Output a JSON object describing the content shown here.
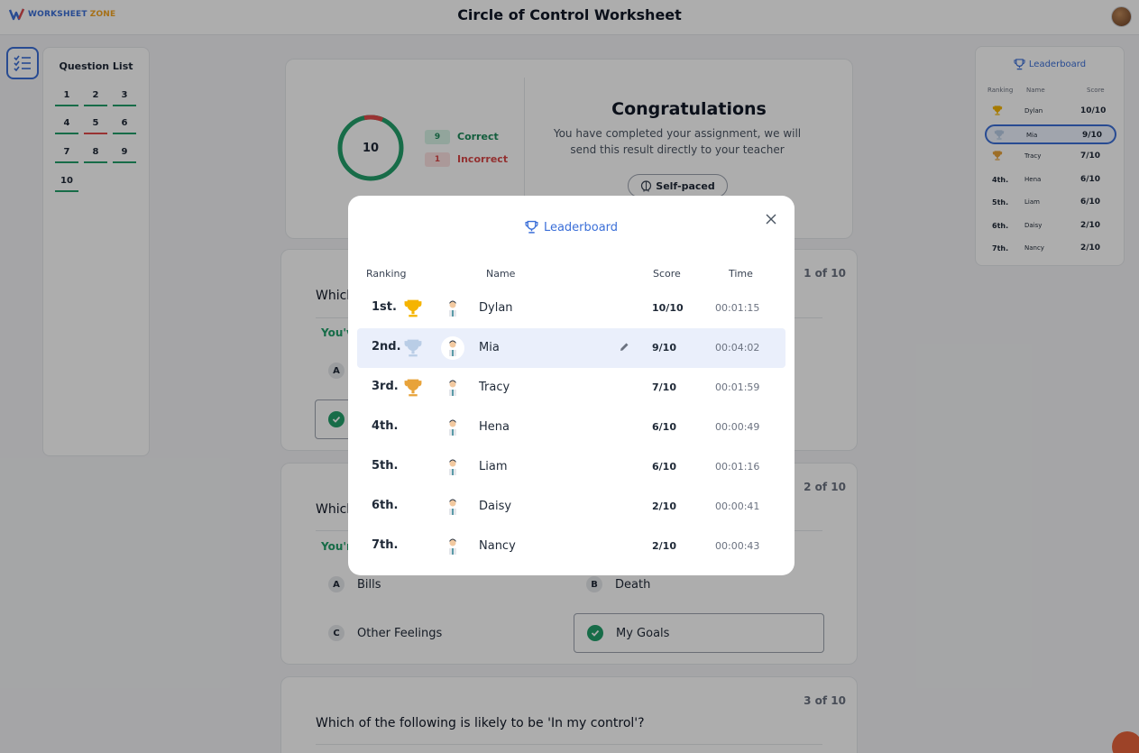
{
  "header": {
    "logo_part1": "WORKSHEET",
    "logo_part2": "ZONE",
    "title": "Circle of Control Worksheet"
  },
  "question_list": {
    "title": "Question List",
    "items": [
      {
        "label": "1",
        "status": "correct"
      },
      {
        "label": "2",
        "status": "correct"
      },
      {
        "label": "3",
        "status": "correct"
      },
      {
        "label": "4",
        "status": "correct"
      },
      {
        "label": "5",
        "status": "incorrect"
      },
      {
        "label": "6",
        "status": "correct"
      },
      {
        "label": "7",
        "status": "correct"
      },
      {
        "label": "8",
        "status": "correct"
      },
      {
        "label": "9",
        "status": "correct"
      },
      {
        "label": "10",
        "status": "correct"
      }
    ]
  },
  "result": {
    "score": "10",
    "correct_count": "9",
    "correct_label": "Correct",
    "incorrect_count": "1",
    "incorrect_label": "Incorrect",
    "heading": "Congratulations",
    "message": "You have completed your assignment, we will send this result directly to your teacher",
    "mode_label": "Self-paced",
    "colors": {
      "correct": "#22a06b",
      "incorrect": "#e24c4c"
    }
  },
  "questions": [
    {
      "counter": "1 of 10",
      "text": "Which",
      "feedback": "You'v",
      "options": [
        {
          "letter": "A",
          "text": ""
        }
      ]
    },
    {
      "counter": "2 of 10",
      "text": "Which",
      "feedback": "You'r",
      "options": [
        {
          "letter": "A",
          "text": "Bills"
        },
        {
          "letter": "B",
          "text": "Death"
        },
        {
          "letter": "C",
          "text": "Other Feelings"
        },
        {
          "letter": "",
          "text": "My Goals",
          "correct": true
        }
      ]
    },
    {
      "counter": "3 of 10",
      "text": "Which of the following is likely to be 'In my control'?"
    }
  ],
  "side_leaderboard": {
    "title": "Leaderboard",
    "headers": {
      "ranking": "Ranking",
      "name": "Name",
      "score": "Score"
    },
    "rows": [
      {
        "rank": "",
        "trophy": "gold",
        "name": "Dylan",
        "score": "10/10"
      },
      {
        "rank": "",
        "trophy": "silver",
        "name": "Mia",
        "score": "9/10",
        "current_user": true
      },
      {
        "rank": "",
        "trophy": "bronze",
        "name": "Tracy",
        "score": "7/10"
      },
      {
        "rank": "4th.",
        "trophy": "",
        "name": "Hena",
        "score": "6/10"
      },
      {
        "rank": "5th.",
        "trophy": "",
        "name": "Liam",
        "score": "6/10"
      },
      {
        "rank": "6th.",
        "trophy": "",
        "name": "Daisy",
        "score": "2/10"
      },
      {
        "rank": "7th.",
        "trophy": "",
        "name": "Nancy",
        "score": "2/10"
      }
    ]
  },
  "modal": {
    "title": "Leaderboard",
    "headers": {
      "ranking": "Ranking",
      "name": "Name",
      "score": "Score",
      "time": "Time"
    },
    "rows": [
      {
        "rank": "1st.",
        "trophy": "gold",
        "name": "Dylan",
        "score": "10/10",
        "time": "00:01:15"
      },
      {
        "rank": "2nd.",
        "trophy": "silver",
        "name": "Mia",
        "score": "9/10",
        "time": "00:04:02",
        "current_user": true
      },
      {
        "rank": "3rd.",
        "trophy": "bronze",
        "name": "Tracy",
        "score": "7/10",
        "time": "00:01:59"
      },
      {
        "rank": "4th.",
        "trophy": "",
        "name": "Hena",
        "score": "6/10",
        "time": "00:00:49"
      },
      {
        "rank": "5th.",
        "trophy": "",
        "name": "Liam",
        "score": "6/10",
        "time": "00:01:16"
      },
      {
        "rank": "6th.",
        "trophy": "",
        "name": "Daisy",
        "score": "2/10",
        "time": "00:00:41"
      },
      {
        "rank": "7th.",
        "trophy": "",
        "name": "Nancy",
        "score": "2/10",
        "time": "00:00:43"
      }
    ]
  },
  "icons": {
    "trophy_colors": {
      "gold": "#f5b400",
      "silver": "#b9cde6",
      "bronze": "#e8a33a"
    },
    "accent": "#3b6fd8"
  }
}
